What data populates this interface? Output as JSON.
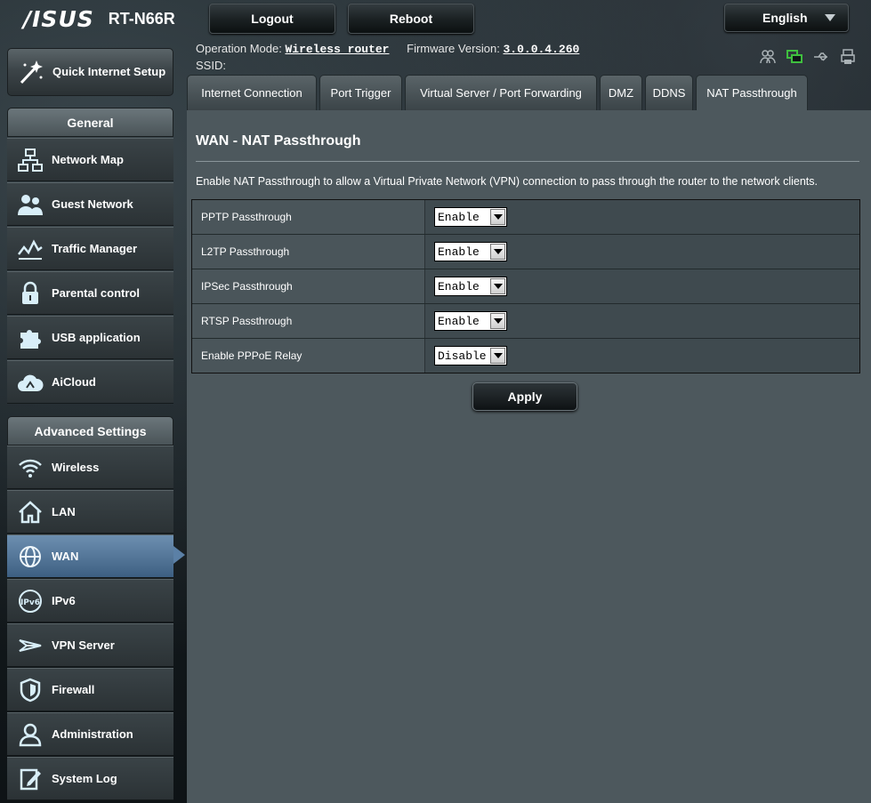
{
  "header": {
    "brand": "/ISUS",
    "model": "RT-N66R",
    "logout_label": "Logout",
    "reboot_label": "Reboot",
    "language": "English"
  },
  "status": {
    "op_mode_label": "Operation Mode:",
    "op_mode_value": "Wireless router",
    "fw_label": "Firmware Version:",
    "fw_value": "3.0.0.4.260",
    "ssid_label": "SSID:"
  },
  "sidebar": {
    "quick_setup": "Quick Internet Setup",
    "general_heading": "General",
    "general_items": [
      {
        "label": "Network Map",
        "icon": "network-map-icon"
      },
      {
        "label": "Guest Network",
        "icon": "guest-network-icon"
      },
      {
        "label": "Traffic Manager",
        "icon": "traffic-manager-icon"
      },
      {
        "label": "Parental control",
        "icon": "lock-icon"
      },
      {
        "label": "USB application",
        "icon": "puzzle-icon"
      },
      {
        "label": "AiCloud",
        "icon": "cloud-icon"
      }
    ],
    "advanced_heading": "Advanced Settings",
    "advanced_items": [
      {
        "label": "Wireless",
        "icon": "wifi-icon"
      },
      {
        "label": "LAN",
        "icon": "home-icon"
      },
      {
        "label": "WAN",
        "icon": "globe-icon"
      },
      {
        "label": "IPv6",
        "icon": "ipv6-icon"
      },
      {
        "label": "VPN Server",
        "icon": "vpn-icon"
      },
      {
        "label": "Firewall",
        "icon": "shield-icon"
      },
      {
        "label": "Administration",
        "icon": "admin-icon"
      },
      {
        "label": "System Log",
        "icon": "log-icon"
      }
    ],
    "active_item": "WAN"
  },
  "tabs": [
    {
      "label": "Internet Connection"
    },
    {
      "label": "Port Trigger"
    },
    {
      "label": "Virtual Server / Port Forwarding"
    },
    {
      "label": "DMZ"
    },
    {
      "label": "DDNS"
    },
    {
      "label": "NAT Passthrough"
    }
  ],
  "main": {
    "title": "WAN - NAT Passthrough",
    "description": "Enable NAT Passthrough to allow a Virtual Private Network (VPN) connection to pass through the router to the network clients.",
    "settings": [
      {
        "label": "PPTP Passthrough",
        "value": "Enable"
      },
      {
        "label": "L2TP Passthrough",
        "value": "Enable"
      },
      {
        "label": "IPSec Passthrough",
        "value": "Enable"
      },
      {
        "label": "RTSP Passthrough",
        "value": "Enable"
      },
      {
        "label": "Enable PPPoE Relay",
        "value": "Disable"
      }
    ],
    "apply_label": "Apply"
  },
  "colors": {
    "panel": "#4d585d",
    "active_nav": "#5b80a6",
    "status_online": "#3fbf3f"
  }
}
